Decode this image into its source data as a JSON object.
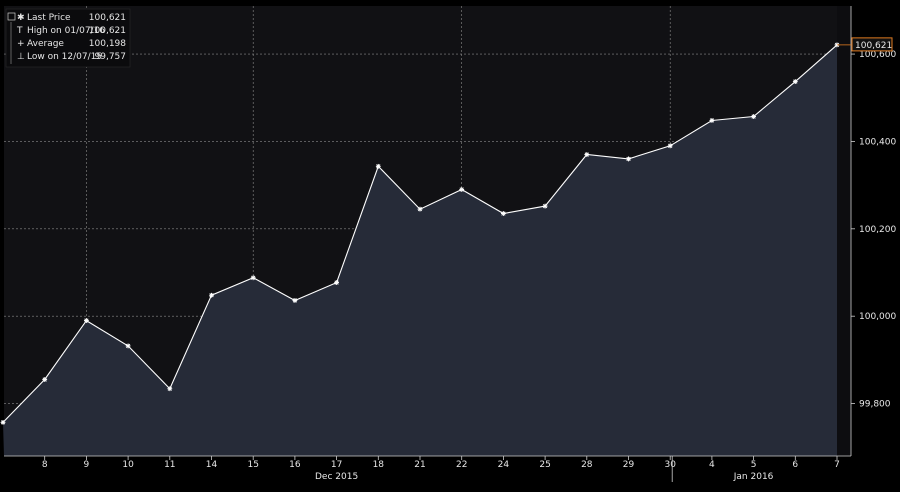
{
  "legend": {
    "items": [
      {
        "symbol": "✱",
        "label": "Last Price",
        "value": "100,621"
      },
      {
        "symbol": "T",
        "label": "High on 01/07/16",
        "value": "100,621"
      },
      {
        "symbol": "+",
        "label": "Average",
        "value": "100,198"
      },
      {
        "symbol": "⊥",
        "label": "Low on 12/07/15",
        "value": "99,757"
      }
    ]
  },
  "last_price_tag": "100,621",
  "colors": {
    "background": "#111114",
    "area_fill": "#262b38",
    "line": "#ffffff",
    "grid": "#8a8a8a",
    "price_tag_border": "#e07a1f",
    "frame": "#000000"
  },
  "chart_data": {
    "type": "area",
    "title": "",
    "xlabel": "",
    "ylabel": "",
    "x": [
      "7",
      "8",
      "9",
      "10",
      "11",
      "14",
      "15",
      "16",
      "17",
      "18",
      "21",
      "22",
      "24",
      "25",
      "28",
      "29",
      "30",
      "4",
      "5",
      "6",
      "7"
    ],
    "x_tick_labels": [
      "8",
      "9",
      "10",
      "11",
      "14",
      "15",
      "16",
      "17",
      "18",
      "21",
      "22",
      "24",
      "25",
      "28",
      "29",
      "30",
      "4",
      "5",
      "6",
      "7"
    ],
    "month_labels": [
      {
        "label": "Dec 2015",
        "at": "17"
      },
      {
        "label": "Jan 2016",
        "at": "5"
      }
    ],
    "series": [
      {
        "name": "Last Price",
        "values": [
          99.757,
          99.855,
          99.99,
          99.932,
          99.834,
          100.048,
          100.088,
          100.036,
          100.077,
          100.343,
          100.245,
          100.29,
          100.235,
          100.252,
          100.37,
          100.36,
          100.39,
          100.448,
          100.457,
          100.537,
          100.621
        ]
      }
    ],
    "y_ticks": [
      99.8,
      100.0,
      100.2,
      100.4,
      100.6
    ],
    "y_tick_labels": [
      "99,800",
      "100,000",
      "100,200",
      "100,400",
      "100,600"
    ],
    "ylim": [
      99.68,
      100.71
    ],
    "grid": true,
    "legend_position": "top-left"
  }
}
